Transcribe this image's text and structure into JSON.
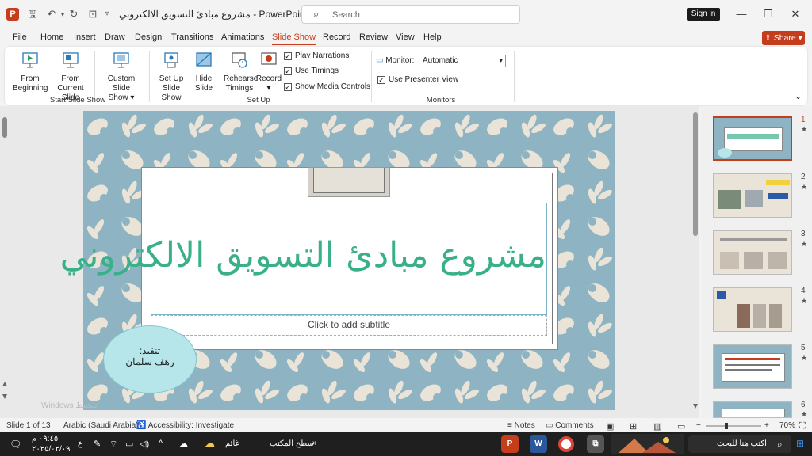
{
  "titlebar": {
    "title": "مشروع مبادئ التسويق الالكتروني  -  PowerPoint",
    "search_placeholder": "Search",
    "signin_label": "Sign in"
  },
  "menu": {
    "tabs": [
      "File",
      "Home",
      "Insert",
      "Draw",
      "Design",
      "Transitions",
      "Animations",
      "Slide Show",
      "Record",
      "Review",
      "View",
      "Help"
    ],
    "active_tab": "Slide Show",
    "share_label": "Share"
  },
  "ribbon": {
    "from_beginning": [
      "From",
      "Beginning"
    ],
    "from_current": [
      "From",
      "Current Slide"
    ],
    "custom_show": [
      "Custom Slide",
      "Show ▾"
    ],
    "group_start": "Start Slide Show",
    "setup_show": [
      "Set Up",
      "Slide Show"
    ],
    "hide_slide": [
      "Hide",
      "Slide"
    ],
    "rehearse": [
      "Rehearse",
      "Timings"
    ],
    "record": [
      "Record",
      "▾"
    ],
    "play_narrations": "Play Narrations",
    "use_timings": "Use Timings",
    "show_media_controls": "Show Media Controls",
    "group_setup": "Set Up",
    "monitor_label": "Monitor:",
    "monitor_value": "Automatic",
    "use_presenter_view": "Use Presenter View",
    "group_monitors": "Monitors"
  },
  "slide": {
    "title": "مشروع مبادئ التسويق الالكتروني",
    "subtitle_placeholder": "Click to add subtitle",
    "oval_line1": "تنفيذ:",
    "oval_line2": "رهف سلمان",
    "watermark": "Windows تنشيط"
  },
  "thumbnails": {
    "numbers": [
      "1",
      "2",
      "3",
      "4",
      "5",
      "6"
    ],
    "star": "★"
  },
  "status": {
    "slide_count": "Slide 1 of 13",
    "language": "Arabic (Saudi Arabia)",
    "accessibility": "Accessibility: Investigate",
    "notes": "Notes",
    "comments": "Comments",
    "zoom": "70%"
  },
  "taskbar": {
    "search_text": "اكتب هنا للبحث",
    "weather": "غائم",
    "desktop": "سطح المكتب",
    "time": "٠٩:٤٥ م",
    "date": "٢٠٢٥/٠٢/٠٩",
    "lang": "ع"
  },
  "colors": {
    "accent": "#c43e1c",
    "slide_bg": "#8eb3c3",
    "title_green": "#3ab08a",
    "oval_fill": "#b6e6ea"
  }
}
